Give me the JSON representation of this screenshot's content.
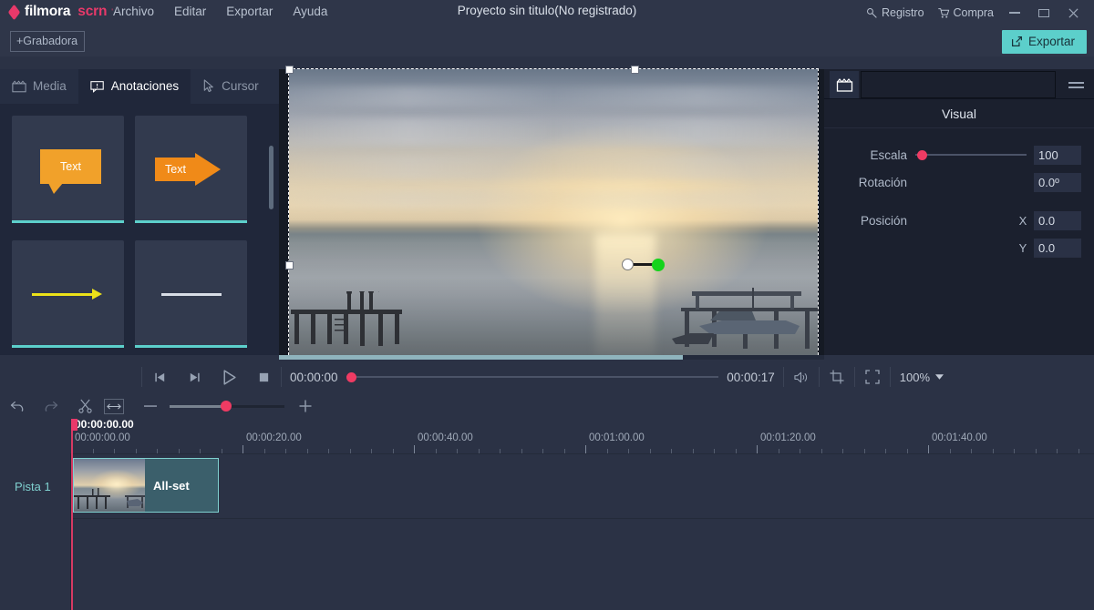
{
  "titlebar": {
    "brand_name": "filmora",
    "brand_suffix": "scrn",
    "brand_tm": "'",
    "menus": [
      "Archivo",
      "Editar",
      "Exportar",
      "Ayuda"
    ],
    "project_title": "Proyecto sin titulo(No registrado)",
    "register_label": "Registro",
    "buy_label": "Compra",
    "recorder_label": "+Grabadora",
    "export_label": "Exportar",
    "icons": {
      "register": "key-icon",
      "buy": "cart-icon",
      "minimize": "minimize-icon",
      "maximize": "maximize-icon",
      "close": "close-icon",
      "export": "external-link-icon"
    }
  },
  "library": {
    "tabs": [
      {
        "label": "Media",
        "icon": "film-clapper-icon",
        "active": false
      },
      {
        "label": "Anotaciones",
        "icon": "callout-icon",
        "active": true
      },
      {
        "label": "Cursor",
        "icon": "pointer-icon",
        "active": false
      }
    ],
    "items": [
      {
        "name": "speech-bubble-annotation",
        "text": "Text",
        "color": "#f1a12a"
      },
      {
        "name": "arrow-tag-annotation",
        "text": "Text",
        "color": "#f08a18"
      },
      {
        "name": "yellow-arrow-annotation",
        "text": "",
        "color": "#ece219"
      },
      {
        "name": "white-line-annotation",
        "text": "",
        "color": "#d8dde6"
      }
    ]
  },
  "properties": {
    "panel_title": "Visual",
    "tab_icon": "film-clapper-icon",
    "menu_icon": "hamburger-menu-icon",
    "scale_label": "Escala",
    "scale_value": "100",
    "rotation_label": "Rotación",
    "rotation_value": "0.0º",
    "position_label": "Posición",
    "x_label": "X",
    "x_value": "0.0",
    "y_label": "Y",
    "y_value": "0.0",
    "accent_color": "#ef3b63"
  },
  "player": {
    "current_time": "00:00:00",
    "duration": "00:00:17",
    "zoom_level": "100%",
    "icons": {
      "prev": "skip-previous-icon",
      "next": "skip-next-icon",
      "play": "play-icon",
      "stop": "stop-icon",
      "volume": "speaker-icon",
      "crop": "crop-icon",
      "fullscreen": "fullscreen-icon",
      "zoom_caret": "chevron-down-icon"
    }
  },
  "timeline_toolbar": {
    "icons": {
      "undo": "undo-icon",
      "redo": "redo-icon",
      "split": "scissors-icon",
      "fit": "fit-to-width-icon",
      "zoom_out": "minus-icon",
      "zoom_in": "plus-icon"
    }
  },
  "timeline": {
    "playhead_time": "00:00:00.00",
    "ruler_labels": [
      "00:00:00.00",
      "00:00:20.00",
      "00:00:40.00",
      "00:01:00.00",
      "00:01:20.00",
      "00:01:40.00"
    ],
    "tracks": [
      {
        "name": "Pista 1",
        "clip_name": "All-set"
      }
    ],
    "accent_color": "#7fd0cf",
    "playhead_color": "#d63a63"
  }
}
